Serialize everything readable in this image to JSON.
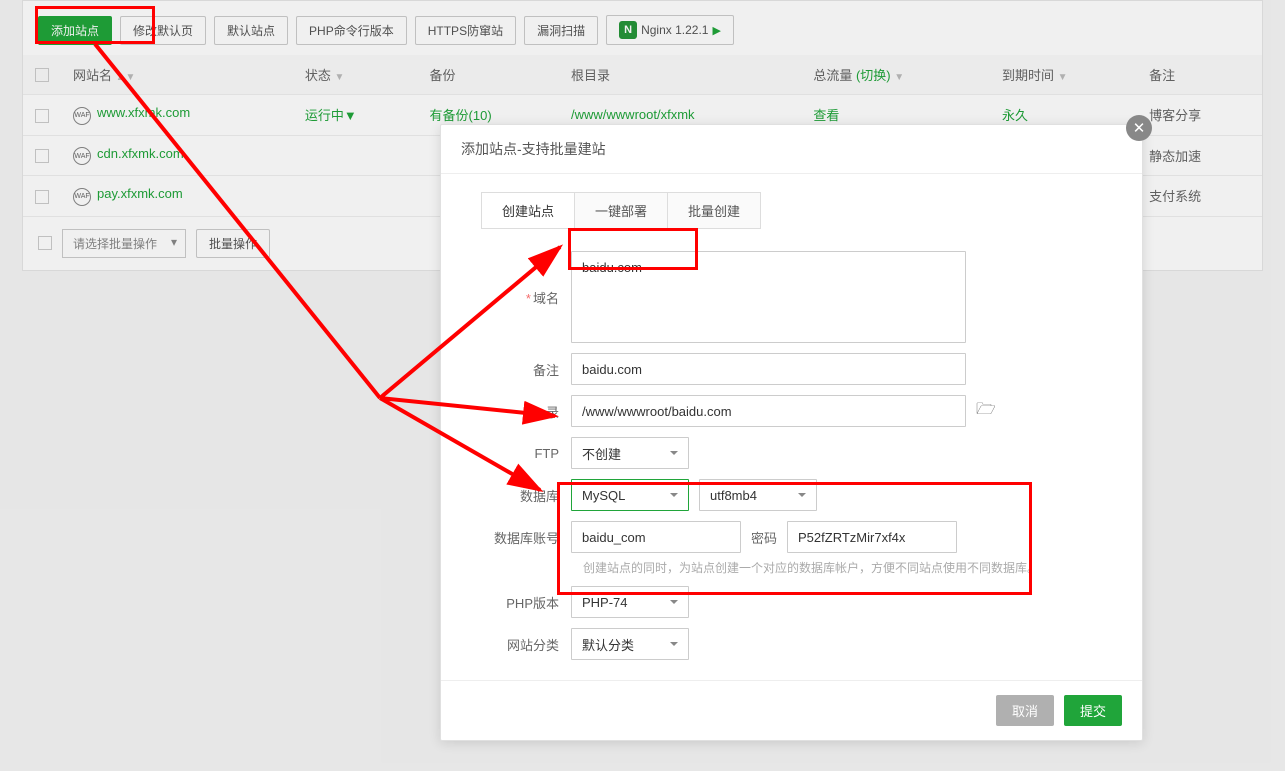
{
  "toolbar": {
    "add_site": "添加站点",
    "modify_default": "修改默认页",
    "default_site": "默认站点",
    "php_cli": "PHP命令行版本",
    "https_waf": "HTTPS防窜站",
    "vuln_scan": "漏洞扫描",
    "nginx_label": "Nginx 1.22.1"
  },
  "table": {
    "headers": {
      "name": "网站名",
      "status": "状态",
      "backup": "备份",
      "root": "根目录",
      "traffic": "总流量",
      "traffic_switch": "(切换)",
      "expire": "到期时间",
      "note": "备注"
    },
    "rows": [
      {
        "name": "www.xfxmk.com",
        "status": "运行中",
        "backup": "有备份(10)",
        "root": "/www/wwwroot/xfxmk",
        "traffic": "查看",
        "expire": "永久",
        "note": "博客分享"
      },
      {
        "name": "cdn.xfxmk.com",
        "status": "",
        "backup": "",
        "root": "",
        "traffic": "",
        "expire": "",
        "note": "静态加速"
      },
      {
        "name": "pay.xfxmk.com",
        "status": "",
        "backup": "",
        "root": "",
        "traffic": "",
        "expire": "",
        "note": "支付系统"
      }
    ]
  },
  "bottom": {
    "batch_select_placeholder": "请选择批量操作",
    "batch_action": "批量操作"
  },
  "modal": {
    "title": "添加站点-支持批量建站",
    "tabs": {
      "create": "创建站点",
      "deploy": "一键部署",
      "batch": "批量创建"
    },
    "labels": {
      "domain": "域名",
      "note": "备注",
      "root": "录",
      "ftp": "FTP",
      "database": "数据库",
      "db_account": "数据库账号",
      "password": "密码",
      "php_version": "PHP版本",
      "category": "网站分类"
    },
    "values": {
      "domain": "baidu.com",
      "note": "baidu.com",
      "root": "/www/wwwroot/baidu.com",
      "ftp": "不创建",
      "db_engine": "MySQL",
      "db_charset": "utf8mb4",
      "db_user": "baidu_com",
      "db_pass": "P52fZRTzMir7xf4x",
      "php": "PHP-74",
      "category": "默认分类"
    },
    "hint": "创建站点的同时，为站点创建一个对应的数据库帐户，方便不同站点使用不同数据库。",
    "buttons": {
      "cancel": "取消",
      "submit": "提交"
    }
  }
}
